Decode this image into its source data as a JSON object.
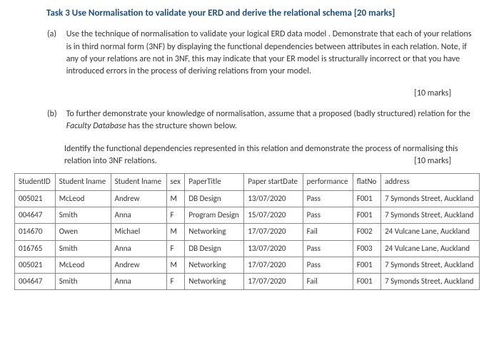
{
  "task": {
    "title": "Task 3  Use Normalisation to validate your ERD and derive the relational schema [20 marks]",
    "sub_a_label": "(a)",
    "sub_a_text": "Use the technique of normalisation to validate your logical ERD data model . Demonstrate that each of your relations is in third normal form (3NF) by displaying the functional dependencies between attributes in each relation. Note, if any of your relations are not in 3NF, this may indicate that your ER model is structurally incorrect or that you have introduced errors in the process of deriving relations from your model.",
    "sub_a_marks": "[10 marks]",
    "sub_b_label": "(b)",
    "sub_b_text_part1": "To further demonstrate your knowledge of normalisation, assume that a proposed (badly structured) relation for the ",
    "sub_b_text_italic": "Faculty Database",
    "sub_b_text_part2": " has the structure shown below.",
    "sub_b_para2": "Identify the functional dependencies represented in this relation and demonstrate the process of normalising this relation into 3NF relations.",
    "sub_b_marks": "[10 marks]"
  },
  "table": {
    "headers": [
      "StudentID",
      "Student lname",
      "Student lname",
      "sex",
      "PaperTitle",
      "Paper startDate",
      "performance",
      "flatNo",
      "address"
    ],
    "rows": [
      [
        "005021",
        "McLeod",
        "Andrew",
        "M",
        "DB Design",
        "13/07/2020",
        "Pass",
        "F001",
        "7 Symonds Street, Auckland"
      ],
      [
        "004647",
        "Smith",
        "Anna",
        "F",
        "Program Design",
        "15/07/2020",
        "Pass",
        "F001",
        "7 Symonds Street, Auckland"
      ],
      [
        "014670",
        "Owen",
        "Michael",
        "M",
        "Networking",
        "17/07/2020",
        "Fail",
        "F002",
        "24 Vulcane Lane, Auckland"
      ],
      [
        "016765",
        "Smith",
        "Anna",
        "F",
        "DB Design",
        "13/07/2020",
        "Pass",
        "F003",
        "24 Vulcane Lane, Auckland"
      ],
      [
        "005021",
        "McLeod",
        "Andrew",
        "M",
        "Networking",
        "17/07/2020",
        "Pass",
        "F001",
        "7 Symonds Street, Auckland"
      ],
      [
        "004647",
        "Smith",
        "Anna",
        "F",
        "Networking",
        "17/07/2020",
        "Fail",
        "F001",
        "7 Symonds Street, Auckland"
      ]
    ]
  }
}
